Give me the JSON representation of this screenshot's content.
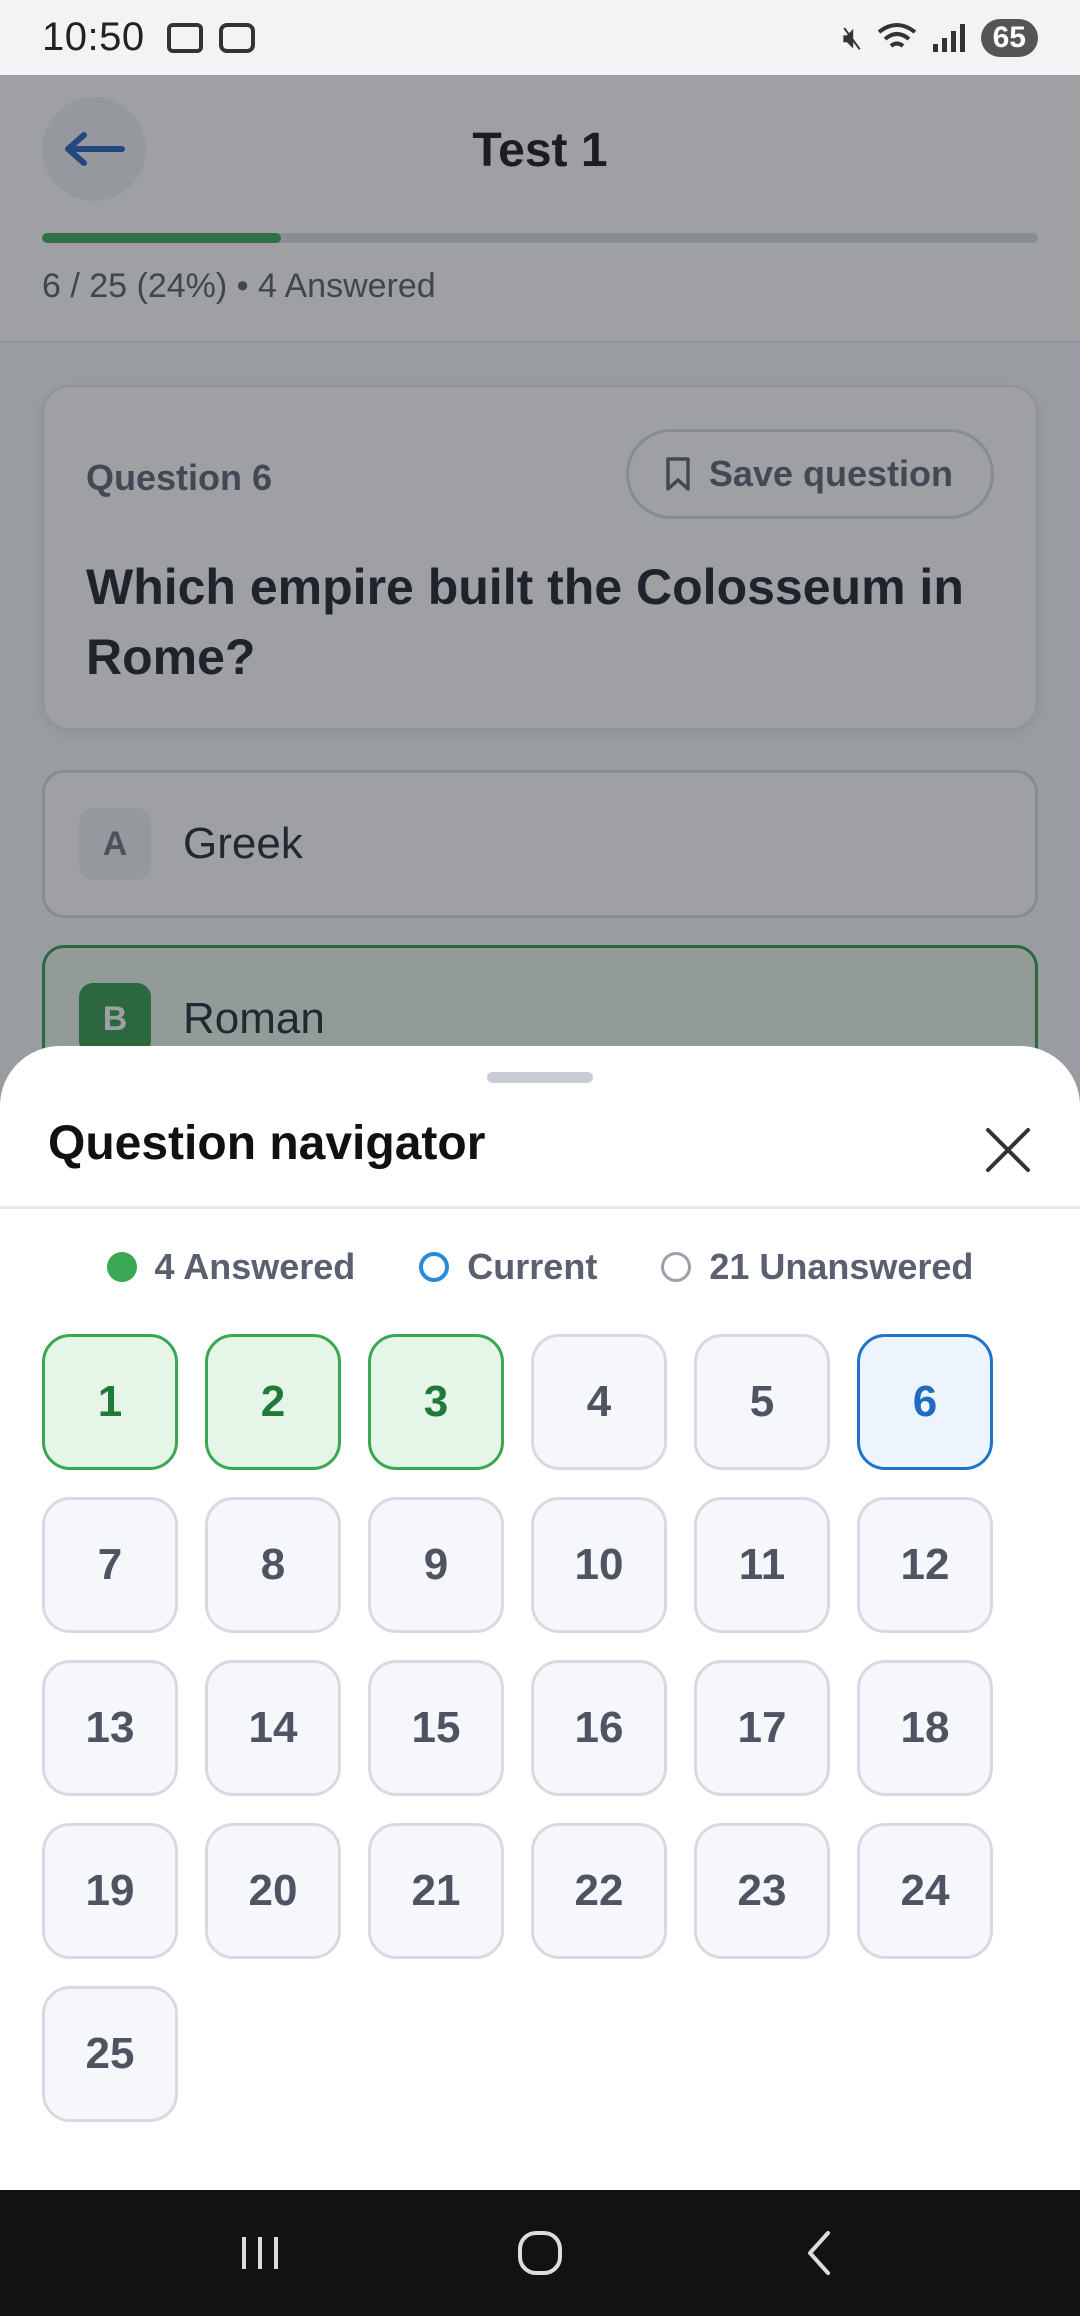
{
  "status_bar": {
    "time": "10:50",
    "battery": "65",
    "icons": [
      "screenshot-icon",
      "voicemail-icon",
      "mute-icon",
      "wifi-icon",
      "signal-icon"
    ]
  },
  "header": {
    "title": "Test 1",
    "progress_text": "6 / 25 (24%) • 4 Answered",
    "progress_fraction": 0.24
  },
  "question": {
    "label": "Question 6",
    "save_label": "Save question",
    "text": "Which empire built the Colosseum in Rome?",
    "options": [
      {
        "letter": "A",
        "text": "Greek",
        "selected": false
      },
      {
        "letter": "B",
        "text": "Roman",
        "selected": true
      }
    ]
  },
  "navigator": {
    "title": "Question navigator",
    "legend": {
      "answered": "4 Answered",
      "current": "Current",
      "unanswered": "21 Unanswered"
    },
    "questions": [
      {
        "n": "1",
        "state": "answered"
      },
      {
        "n": "2",
        "state": "answered"
      },
      {
        "n": "3",
        "state": "answered"
      },
      {
        "n": "4",
        "state": "unanswered"
      },
      {
        "n": "5",
        "state": "unanswered"
      },
      {
        "n": "6",
        "state": "current"
      },
      {
        "n": "7",
        "state": "unanswered"
      },
      {
        "n": "8",
        "state": "unanswered"
      },
      {
        "n": "9",
        "state": "unanswered"
      },
      {
        "n": "10",
        "state": "unanswered"
      },
      {
        "n": "11",
        "state": "unanswered"
      },
      {
        "n": "12",
        "state": "unanswered"
      },
      {
        "n": "13",
        "state": "unanswered"
      },
      {
        "n": "14",
        "state": "unanswered"
      },
      {
        "n": "15",
        "state": "unanswered"
      },
      {
        "n": "16",
        "state": "unanswered"
      },
      {
        "n": "17",
        "state": "unanswered"
      },
      {
        "n": "18",
        "state": "unanswered"
      },
      {
        "n": "19",
        "state": "unanswered"
      },
      {
        "n": "20",
        "state": "unanswered"
      },
      {
        "n": "21",
        "state": "unanswered"
      },
      {
        "n": "22",
        "state": "unanswered"
      },
      {
        "n": "23",
        "state": "unanswered"
      },
      {
        "n": "24",
        "state": "unanswered"
      },
      {
        "n": "25",
        "state": "unanswered"
      }
    ]
  },
  "colors": {
    "answered": "#3aa753",
    "current": "#1f74c9",
    "accent_back": "#1f5fbf"
  }
}
